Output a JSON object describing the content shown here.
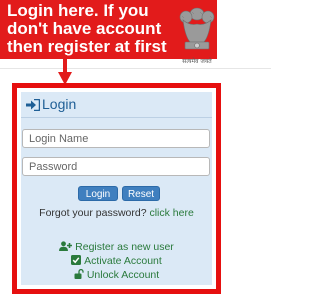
{
  "callout": {
    "lines": [
      "Login here. If you",
      "don't have account",
      "then register at first"
    ]
  },
  "emblem": {
    "motto": "सत्यमेव जयते"
  },
  "login": {
    "title": "Login",
    "username_placeholder": "Login Name",
    "password_placeholder": "Password",
    "login_button": "Login",
    "reset_button": "Reset",
    "forgot_text": "Forgot your password?",
    "forgot_link": "click here",
    "register_link": "Register as new user",
    "activate_link": "Activate Account",
    "unlock_link": "Unlock Account"
  },
  "colors": {
    "callout_bg": "#e21b1b",
    "frame_border": "#e60f0f",
    "panel_bg": "#dbe9f6",
    "header_text": "#1f5f96",
    "button_bg": "#3f7fbf",
    "link_green": "#2a7a3c"
  },
  "icons": {
    "header": "sign-in-icon",
    "register": "user-plus-icon",
    "activate": "check-square-icon",
    "unlock": "unlock-icon",
    "emblem": "national-emblem-icon",
    "arrow": "down-arrow-icon"
  }
}
